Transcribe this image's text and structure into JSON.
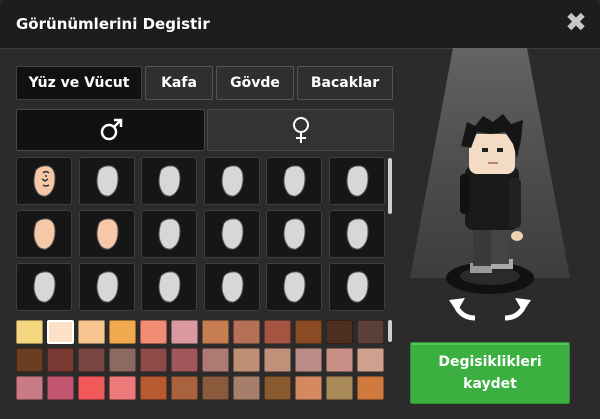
{
  "window": {
    "title": "Görünümlerini Degistir"
  },
  "tabs": [
    {
      "label": "Yüz ve Vücut",
      "active": true
    },
    {
      "label": "Kafa",
      "active": false
    },
    {
      "label": "Gövde",
      "active": false
    },
    {
      "label": "Bacaklar",
      "active": false
    }
  ],
  "gender": {
    "male": {
      "icon": "male-symbol-icon",
      "glyph": "♂",
      "selected": true
    },
    "female": {
      "icon": "female-symbol-icon",
      "glyph": "♀",
      "selected": false
    }
  },
  "face_options": [
    {
      "icon": "face-selected-icon",
      "selected": true
    },
    {
      "icon": "face-placeholder-icon"
    },
    {
      "icon": "face-placeholder-icon"
    },
    {
      "icon": "face-placeholder-icon"
    },
    {
      "icon": "face-placeholder-icon"
    },
    {
      "icon": "face-placeholder-icon"
    },
    {
      "icon": "face-skin-icon"
    },
    {
      "icon": "face-skin-icon"
    },
    {
      "icon": "face-placeholder-icon"
    },
    {
      "icon": "face-placeholder-icon"
    },
    {
      "icon": "face-placeholder-icon"
    },
    {
      "icon": "face-placeholder-icon"
    },
    {
      "icon": "face-placeholder-icon"
    },
    {
      "icon": "face-placeholder-icon"
    },
    {
      "icon": "face-placeholder-icon"
    },
    {
      "icon": "face-placeholder-icon"
    },
    {
      "icon": "face-placeholder-icon"
    },
    {
      "icon": "face-placeholder-icon"
    }
  ],
  "colors": {
    "selected_skin": "#f7c8a8",
    "placeholder": "#d7d7d7",
    "swatches": [
      "#f5d77f",
      "#fde0c8",
      "#f9c590",
      "#f0a94e",
      "#f28c74",
      "#d9999e",
      "#c77d52",
      "#b77058",
      "#a65442",
      "#8a4a24",
      "#4e2f1f",
      "#5a4036",
      "#6b3d22",
      "#7a3a34",
      "#7a4644",
      "#8c6a60",
      "#8e4a46",
      "#a0565a",
      "#b07a74",
      "#c08e76",
      "#c09078",
      "#ba8c86",
      "#c98f86",
      "#d0a08e",
      "#c87a86",
      "#c25670",
      "#f25a5a",
      "#f07a7a",
      "#b85a30",
      "#a86240",
      "#8a5a3c",
      "#a67e6a",
      "#8a5a30",
      "#d48a5e",
      "#ab8a5a",
      "#d07a40"
    ]
  },
  "save_button": {
    "line1": "Degisiklikleri",
    "line2": "kaydet"
  }
}
